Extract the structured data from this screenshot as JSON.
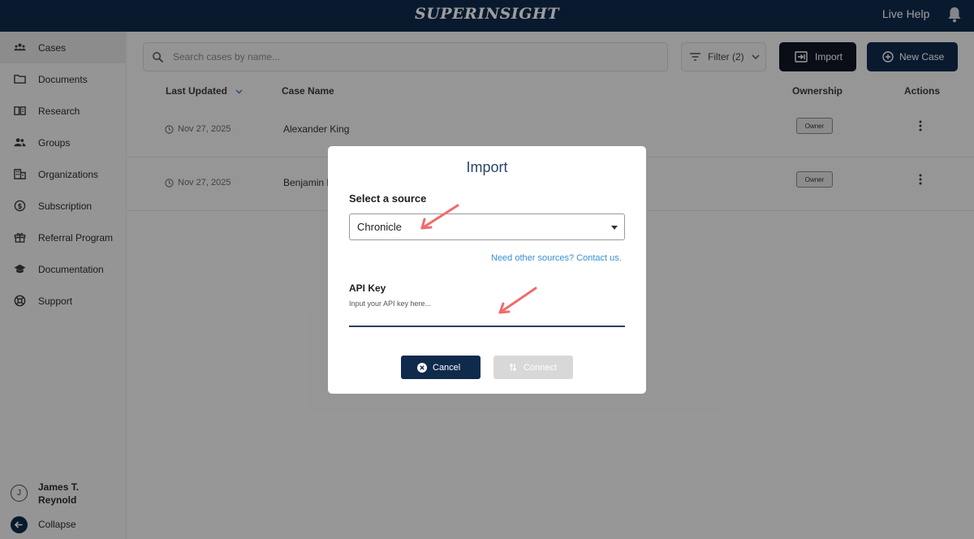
{
  "header": {
    "brand": "SUPERINSIGHT",
    "live_help": "Live Help"
  },
  "sidebar": {
    "items": [
      {
        "label": "Cases",
        "icon": "cases-icon",
        "active": true
      },
      {
        "label": "Documents",
        "icon": "folder-icon"
      },
      {
        "label": "Research",
        "icon": "book-icon"
      },
      {
        "label": "Groups",
        "icon": "groups-icon"
      },
      {
        "label": "Organizations",
        "icon": "building-icon"
      },
      {
        "label": "Subscription",
        "icon": "dollar-icon"
      },
      {
        "label": "Referral Program",
        "icon": "gift-icon"
      },
      {
        "label": "Documentation",
        "icon": "school-icon"
      },
      {
        "label": "Support",
        "icon": "lifebuoy-icon"
      }
    ],
    "user": {
      "initial": "J",
      "name": "James T. Reynold"
    },
    "collapse_label": "Collapse"
  },
  "toolbar": {
    "search_placeholder": "Search cases by name...",
    "filter_label": "Filter (2)",
    "import_label": "Import",
    "new_case_label": "New Case"
  },
  "table": {
    "columns": {
      "last_updated": "Last Updated",
      "case_name": "Case Name",
      "ownership": "Ownership",
      "actions": "Actions"
    },
    "rows": [
      {
        "date": "Nov 27, 2025",
        "name": "Alexander King",
        "ownership": "Owner"
      },
      {
        "date": "Nov 27, 2025",
        "name": "Benjamin H",
        "ownership": "Owner"
      }
    ]
  },
  "modal": {
    "title": "Import",
    "source_label": "Select a source",
    "source_value": "Chronicle",
    "contact_link": "Need other sources? Contact us.",
    "api_label": "API Key",
    "api_placeholder": "Input your API key here...",
    "cancel_label": "Cancel",
    "connect_label": "Connect"
  },
  "colors": {
    "navy": "#102a4c",
    "import_black": "#0f1622",
    "link_blue": "#3a8fd0",
    "annotation_red": "#ef6b6b"
  }
}
